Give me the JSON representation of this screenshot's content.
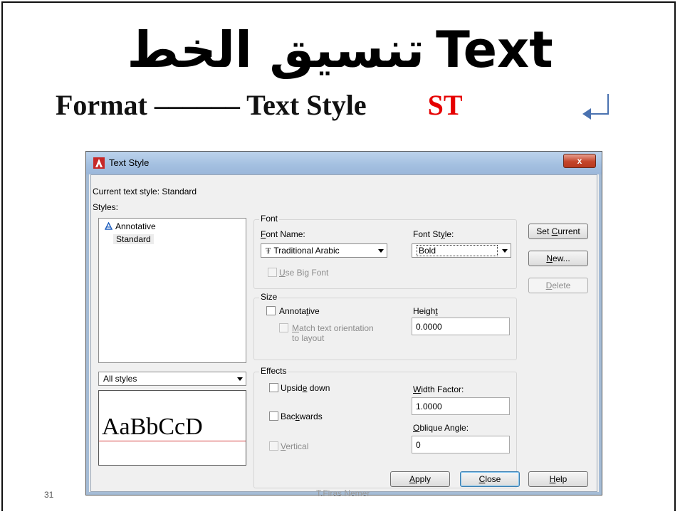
{
  "slide": {
    "title_ar": "تنسيق الخط",
    "title_en": "Text",
    "subtitle": "Format –––––– Text Style",
    "command": "ST",
    "number": "31",
    "author": "T.Firas Nemer"
  },
  "dialog": {
    "title": "Text Style",
    "close_label": "x",
    "current_style_label": "Current text style:  Standard",
    "styles_label": "Styles:",
    "styles": [
      {
        "label": "Annotative",
        "icon": "annotative-icon"
      },
      {
        "label": "Standard",
        "selected": true
      }
    ],
    "filter_value": "All styles",
    "preview_text": "AaBbCcD",
    "font": {
      "group_label": "Font",
      "name_label": "Font Name:",
      "name_value": "Traditional Arabic",
      "style_label": "Font Style:",
      "style_value": "Bold",
      "big_font_label": "Use Big Font"
    },
    "size": {
      "group_label": "Size",
      "annotative_label": "Annotative",
      "match_label": "Match text orientation",
      "match_label2": "to layout",
      "height_label": "Height",
      "height_value": "0.0000"
    },
    "effects": {
      "group_label": "Effects",
      "upside_down_label": "Upside down",
      "backwards_label": "Backwards",
      "vertical_label": "Vertical",
      "width_factor_label": "Width Factor:",
      "width_factor_value": "1.0000",
      "oblique_label": "Oblique Angle:",
      "oblique_value": "0"
    },
    "buttons": {
      "set_current": "Set Current",
      "new": "New...",
      "delete": "Delete",
      "apply": "Apply",
      "close": "Close",
      "help": "Help"
    }
  }
}
